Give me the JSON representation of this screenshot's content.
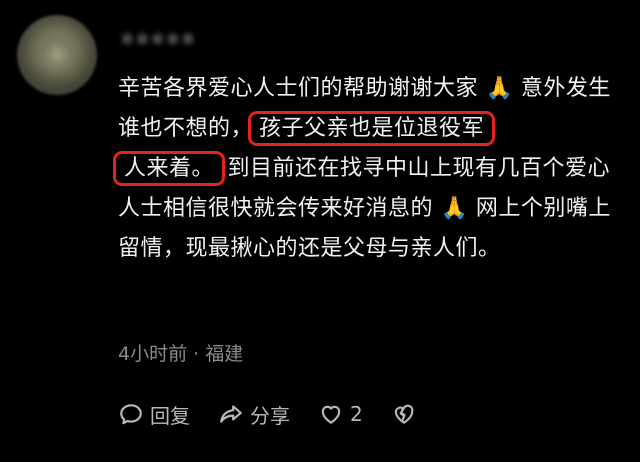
{
  "comment": {
    "username": "※※※※※",
    "text_part1": "辛苦各界爱心人士们的帮助谢谢大家",
    "emoji_1": "🙏",
    "text_part2": "意外发生谁也不想的，",
    "highlight_1": "孩子父亲也是位退役军",
    "highlight_2": "人来着。",
    "text_part3": "到目前还在找寻中山上现有几百个爱心人士相信很快就会传来好消息的",
    "emoji_2": "🙏",
    "text_part4": "网上个别嘴上留情，现最揪心的还是父母与亲人们。",
    "meta": "4小时前 · 福建",
    "actions": {
      "reply_label": "回复",
      "share_label": "分享",
      "like_count": "2"
    },
    "icons": [
      "reply-icon",
      "share-icon",
      "heart-icon",
      "broken-heart-icon"
    ],
    "highlight_color": "#e3241b"
  }
}
